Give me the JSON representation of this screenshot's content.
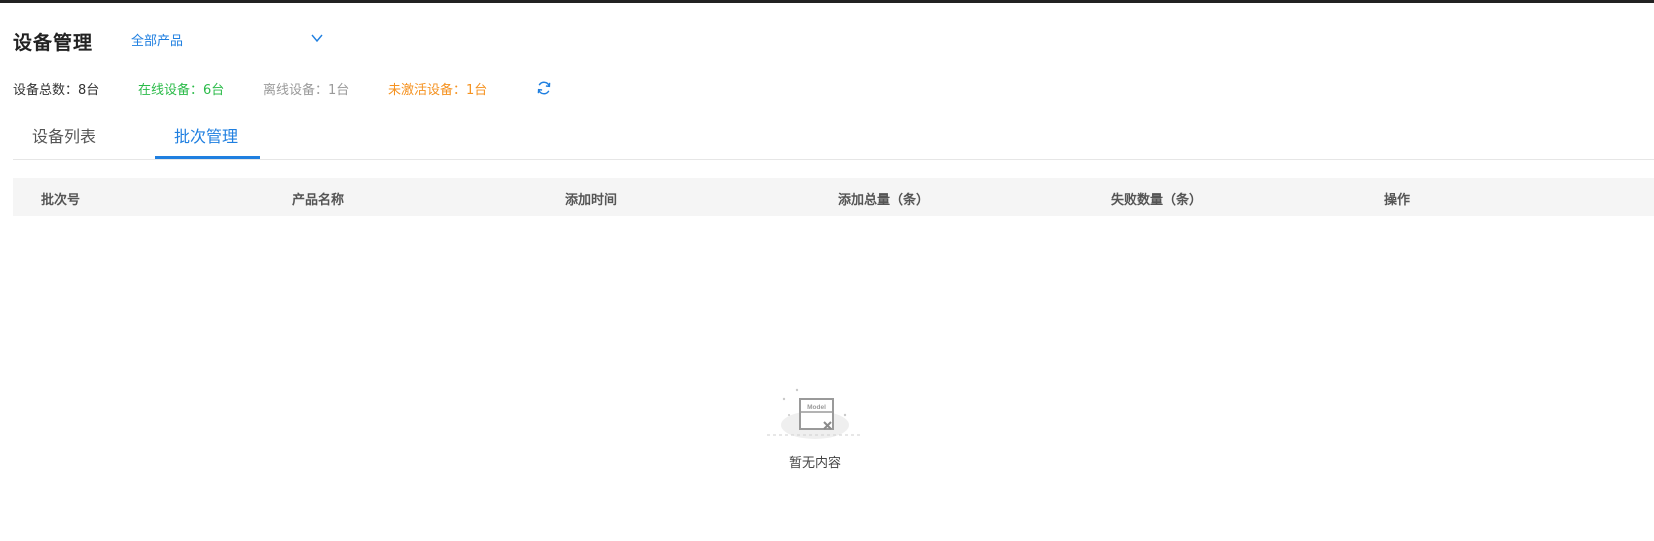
{
  "page": {
    "title": "设备管理",
    "product_select": {
      "value": "全部产品",
      "icon": "chevron-down-icon"
    }
  },
  "stats": {
    "total": "设备总数：8台",
    "online": "在线设备：6台",
    "offline": "离线设备：1台",
    "inactive": "未激活设备：1台",
    "refresh_icon": "refresh-icon",
    "colors": {
      "online": "#2bbb49",
      "offline": "#9a9a9a",
      "inactive": "#f59220",
      "accent": "#1f7fe0"
    }
  },
  "tabs": [
    {
      "label": "设备列表",
      "active": false
    },
    {
      "label": "批次管理",
      "active": true
    }
  ],
  "table": {
    "columns": [
      "批次号",
      "产品名称",
      "添加时间",
      "添加总量（条）",
      "失败数量（条）",
      "操作"
    ],
    "rows": [],
    "empty": {
      "illustration_label": "Model",
      "text": "暂无内容"
    }
  }
}
